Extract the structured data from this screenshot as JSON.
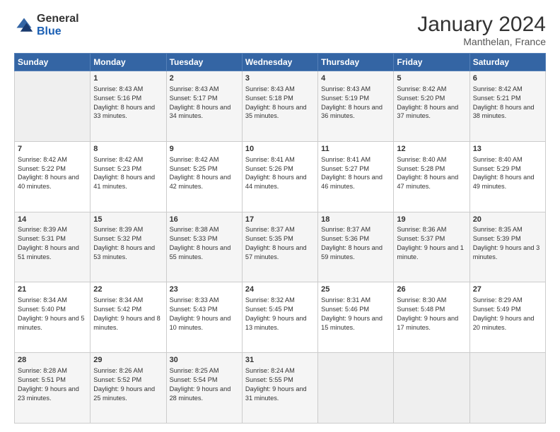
{
  "header": {
    "logo_general": "General",
    "logo_blue": "Blue",
    "main_title": "January 2024",
    "subtitle": "Manthelan, France"
  },
  "days_of_week": [
    "Sunday",
    "Monday",
    "Tuesday",
    "Wednesday",
    "Thursday",
    "Friday",
    "Saturday"
  ],
  "weeks": [
    {
      "days": [
        {
          "num": "",
          "empty": true
        },
        {
          "num": "1",
          "sunrise": "8:43 AM",
          "sunset": "5:16 PM",
          "daylight": "8 hours and 33 minutes."
        },
        {
          "num": "2",
          "sunrise": "8:43 AM",
          "sunset": "5:17 PM",
          "daylight": "8 hours and 34 minutes."
        },
        {
          "num": "3",
          "sunrise": "8:43 AM",
          "sunset": "5:18 PM",
          "daylight": "8 hours and 35 minutes."
        },
        {
          "num": "4",
          "sunrise": "8:43 AM",
          "sunset": "5:19 PM",
          "daylight": "8 hours and 36 minutes."
        },
        {
          "num": "5",
          "sunrise": "8:42 AM",
          "sunset": "5:20 PM",
          "daylight": "8 hours and 37 minutes."
        },
        {
          "num": "6",
          "sunrise": "8:42 AM",
          "sunset": "5:21 PM",
          "daylight": "8 hours and 38 minutes."
        }
      ]
    },
    {
      "days": [
        {
          "num": "7",
          "sunrise": "8:42 AM",
          "sunset": "5:22 PM",
          "daylight": "8 hours and 40 minutes."
        },
        {
          "num": "8",
          "sunrise": "8:42 AM",
          "sunset": "5:23 PM",
          "daylight": "8 hours and 41 minutes."
        },
        {
          "num": "9",
          "sunrise": "8:42 AM",
          "sunset": "5:25 PM",
          "daylight": "8 hours and 42 minutes."
        },
        {
          "num": "10",
          "sunrise": "8:41 AM",
          "sunset": "5:26 PM",
          "daylight": "8 hours and 44 minutes."
        },
        {
          "num": "11",
          "sunrise": "8:41 AM",
          "sunset": "5:27 PM",
          "daylight": "8 hours and 46 minutes."
        },
        {
          "num": "12",
          "sunrise": "8:40 AM",
          "sunset": "5:28 PM",
          "daylight": "8 hours and 47 minutes."
        },
        {
          "num": "13",
          "sunrise": "8:40 AM",
          "sunset": "5:29 PM",
          "daylight": "8 hours and 49 minutes."
        }
      ]
    },
    {
      "days": [
        {
          "num": "14",
          "sunrise": "8:39 AM",
          "sunset": "5:31 PM",
          "daylight": "8 hours and 51 minutes."
        },
        {
          "num": "15",
          "sunrise": "8:39 AM",
          "sunset": "5:32 PM",
          "daylight": "8 hours and 53 minutes."
        },
        {
          "num": "16",
          "sunrise": "8:38 AM",
          "sunset": "5:33 PM",
          "daylight": "8 hours and 55 minutes."
        },
        {
          "num": "17",
          "sunrise": "8:37 AM",
          "sunset": "5:35 PM",
          "daylight": "8 hours and 57 minutes."
        },
        {
          "num": "18",
          "sunrise": "8:37 AM",
          "sunset": "5:36 PM",
          "daylight": "8 hours and 59 minutes."
        },
        {
          "num": "19",
          "sunrise": "8:36 AM",
          "sunset": "5:37 PM",
          "daylight": "9 hours and 1 minute."
        },
        {
          "num": "20",
          "sunrise": "8:35 AM",
          "sunset": "5:39 PM",
          "daylight": "9 hours and 3 minutes."
        }
      ]
    },
    {
      "days": [
        {
          "num": "21",
          "sunrise": "8:34 AM",
          "sunset": "5:40 PM",
          "daylight": "9 hours and 5 minutes."
        },
        {
          "num": "22",
          "sunrise": "8:34 AM",
          "sunset": "5:42 PM",
          "daylight": "9 hours and 8 minutes."
        },
        {
          "num": "23",
          "sunrise": "8:33 AM",
          "sunset": "5:43 PM",
          "daylight": "9 hours and 10 minutes."
        },
        {
          "num": "24",
          "sunrise": "8:32 AM",
          "sunset": "5:45 PM",
          "daylight": "9 hours and 13 minutes."
        },
        {
          "num": "25",
          "sunrise": "8:31 AM",
          "sunset": "5:46 PM",
          "daylight": "9 hours and 15 minutes."
        },
        {
          "num": "26",
          "sunrise": "8:30 AM",
          "sunset": "5:48 PM",
          "daylight": "9 hours and 17 minutes."
        },
        {
          "num": "27",
          "sunrise": "8:29 AM",
          "sunset": "5:49 PM",
          "daylight": "9 hours and 20 minutes."
        }
      ]
    },
    {
      "days": [
        {
          "num": "28",
          "sunrise": "8:28 AM",
          "sunset": "5:51 PM",
          "daylight": "9 hours and 23 minutes."
        },
        {
          "num": "29",
          "sunrise": "8:26 AM",
          "sunset": "5:52 PM",
          "daylight": "9 hours and 25 minutes."
        },
        {
          "num": "30",
          "sunrise": "8:25 AM",
          "sunset": "5:54 PM",
          "daylight": "9 hours and 28 minutes."
        },
        {
          "num": "31",
          "sunrise": "8:24 AM",
          "sunset": "5:55 PM",
          "daylight": "9 hours and 31 minutes."
        },
        {
          "num": "",
          "empty": true
        },
        {
          "num": "",
          "empty": true
        },
        {
          "num": "",
          "empty": true
        }
      ]
    }
  ]
}
